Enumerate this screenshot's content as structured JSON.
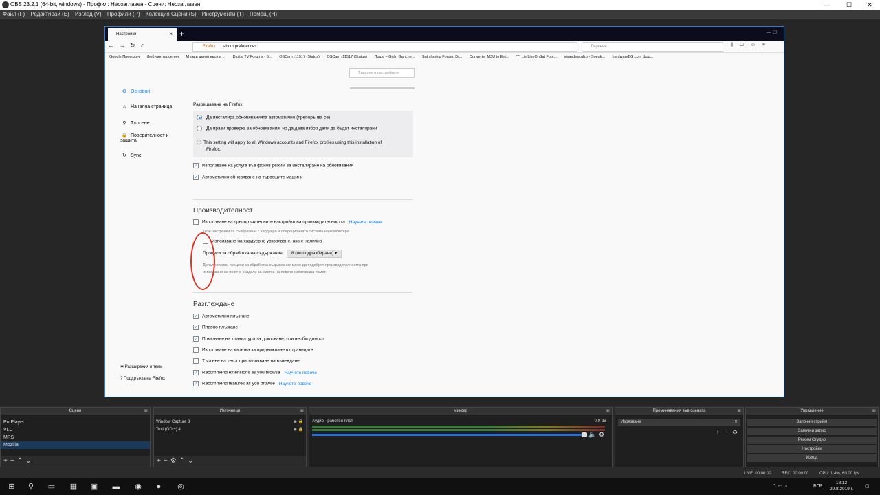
{
  "window": {
    "title": "OBS 23.2.1 (64-bit, windows) - Профил: Неозаглавен - Сцени: Неозаглавен",
    "minimize": "—",
    "maximize": "☐",
    "close": "✕"
  },
  "menu": [
    "Файл (F)",
    "Редактирай (E)",
    "Изглед (V)",
    "Профили (P)",
    "Колекция Сцени (S)",
    "Инструменти (T)",
    "Помощ (H)"
  ],
  "firefox": {
    "tab_title": "Настройки",
    "tab_close": "×",
    "new_tab": "+",
    "win_controls": "—   ☐",
    "url_brand": "Firefox",
    "url": "about:preferences",
    "search_placeholder": "Търсене",
    "bookmarks": [
      "Google Преводач",
      "Любими търсения",
      "Мъжки дънки къси и ...",
      "Digital TV Forums - Б...",
      "OSCam r11517 (Status)",
      "OSCam r11517 (Status)",
      "Поща – Galin Ganche...",
      "Sat sharing Forum, Dr...",
      "Converter M3U to Eni...",
      "*** Lis LiveOnSat Foot...",
      "sivasdescalzo - Sneak...",
      "hardwareBG.com фор..."
    ],
    "prefs_search_placeholder": "Търсене в настройките",
    "sidebar": [
      {
        "icon": "gear-icon",
        "glyph": "⚙",
        "label": "Основни"
      },
      {
        "icon": "home-icon",
        "glyph": "⌂",
        "label": "Начална страница"
      },
      {
        "icon": "search-icon",
        "glyph": "⚲",
        "label": "Търсене"
      },
      {
        "icon": "lock-icon",
        "glyph": "🔒",
        "label": "Поверителност и защита"
      },
      {
        "icon": "sync-icon",
        "glyph": "↻",
        "label": "Sync"
      }
    ],
    "sidebar_bottom": [
      "Разширения и теми",
      "Поддръжка на Firefox"
    ],
    "updates_heading": "Разрешаване на Firefox",
    "update_opt_auto": "Да инсталира обновяванията автоматично (препоръчва се)",
    "update_opt_check": "Да прави проверка за обновявания, но да дава избор дали да бъдат инсталирани",
    "update_info_line1": "This setting will apply to all Windows accounts and Firefox profiles using this installation of",
    "update_info_line2": "Firefox.",
    "opt_bg_service": "Използване на услуга във фонов режим за инсталиране на обновявания",
    "opt_auto_search": "Автоматично обновяване на търсещите машини",
    "perf_title": "Производителност",
    "perf_recommended": "Използване на препоръчителните настройки на производителността",
    "learn_more": "Научете повече",
    "perf_note": "Тези настройки са съобразени с хардуера и операционната система на компютъра.",
    "perf_hw": "Използване на хардуерно ускоряване, ако е налично",
    "perf_proc_label": "Процеси за обработка на съдържание",
    "perf_proc_value": "8 (по подразбиране)",
    "perf_proc_note1": "Допълнителни процеси за обработка съдържание може да подобрят производителността при",
    "perf_proc_note2": "използване на повече раздели за сметка на повече използвана памет.",
    "browse_title": "Разглеждане",
    "browse_opts": [
      {
        "label": "Автоматично плъзгане",
        "checked": true
      },
      {
        "label": "Плавно плъзгане",
        "checked": true
      },
      {
        "label": "Показване на клавиатура за докосване, при необходимост",
        "checked": true
      },
      {
        "label": "Използване на каретка за придвижване в страниците",
        "checked": false
      },
      {
        "label": "Търсене на текст при започване на въвеждане",
        "checked": false
      },
      {
        "label": "Recommend extensions as you browse",
        "checked": true,
        "link": true
      },
      {
        "label": "Recommend features as you browse",
        "checked": true,
        "link": true
      }
    ]
  },
  "docks": {
    "scenes_title": "Сцени",
    "scenes": [
      "PotPlayer",
      "VLC",
      "MPS",
      "Mozilla"
    ],
    "sources_title": "Източници",
    "sources": [
      "Window Capture 3",
      "Text (GDI+) 4"
    ],
    "mixer_title": "Миксер",
    "mixer_channel": "Аудио - работен плот",
    "mixer_db": "0.0 dB",
    "transitions_title": "Преминавания във сцената",
    "transition_value": "Изрязване",
    "controls_title": "Управление",
    "controls": [
      "Започни стрийм",
      "Започни запис",
      "Режим Студио",
      "Настройки",
      "Изход"
    ]
  },
  "status": {
    "live": "LIVE: 00:00:00",
    "rec": "REC: 00:00:00",
    "cpu": "CPU: 1.4%, 60.00 fps"
  },
  "taskbar": {
    "lang": "БГР",
    "time": "18:12",
    "date": "29.8.2019 г."
  }
}
